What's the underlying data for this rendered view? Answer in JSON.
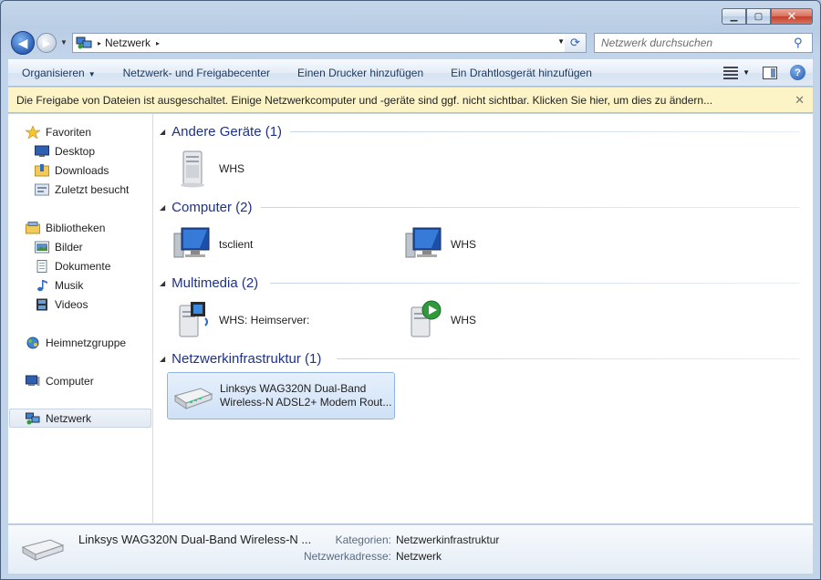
{
  "window": {
    "caption": {
      "minimize": "▁",
      "maximize": "▢",
      "close": "✕"
    }
  },
  "nav": {
    "back": "◀",
    "forward": "▶",
    "breadcrumb": [
      "Netzwerk"
    ],
    "breadcrumb_sep": "▸",
    "search_placeholder": "Netzwerk durchsuchen"
  },
  "commandbar": {
    "items": [
      "Organisieren",
      "Netzwerk- und Freigabecenter",
      "Einen Drucker hinzufügen",
      "Ein Drahtlosgerät hinzufügen"
    ],
    "organize_arrow": "▼",
    "help": "?"
  },
  "infobar": {
    "text": "Die Freigabe von Dateien ist ausgeschaltet. Einige Netzwerkcomputer und -geräte sind ggf. nicht sichtbar. Klicken Sie hier, um dies zu ändern...",
    "close": "✕"
  },
  "navpane": {
    "favorites": "Favoriten",
    "desktop": "Desktop",
    "downloads": "Downloads",
    "recent": "Zuletzt besucht",
    "libraries": "Bibliotheken",
    "pictures": "Bilder",
    "documents": "Dokumente",
    "music": "Musik",
    "videos": "Videos",
    "homegroup": "Heimnetzgruppe",
    "computer": "Computer",
    "network": "Netzwerk"
  },
  "groups": [
    {
      "title": "Andere Geräte (1)",
      "items": [
        {
          "label": "WHS",
          "icon": "server-icon"
        }
      ]
    },
    {
      "title": "Computer (2)",
      "items": [
        {
          "label": "tsclient",
          "icon": "monitor-icon"
        },
        {
          "label": "WHS",
          "icon": "monitor-icon"
        }
      ]
    },
    {
      "title": "Multimedia (2)",
      "items": [
        {
          "label": "WHS: Heimserver:",
          "icon": "media-server-icon"
        },
        {
          "label": "WHS",
          "icon": "media-play-server-icon"
        }
      ]
    },
    {
      "title": "Netzwerkinfrastruktur (1)",
      "items": [
        {
          "label_line1": "Linksys WAG320N Dual-Band",
          "label_line2": "Wireless-N ADSL2+ Modem Rout...",
          "icon": "router-icon"
        }
      ]
    }
  ],
  "details": {
    "name": "Linksys WAG320N Dual-Band Wireless-N ...",
    "category_label": "Kategorien:",
    "category_value": "Netzwerkinfrastruktur",
    "address_label": "Netzwerkadresse:",
    "address_value": "Netzwerk"
  }
}
